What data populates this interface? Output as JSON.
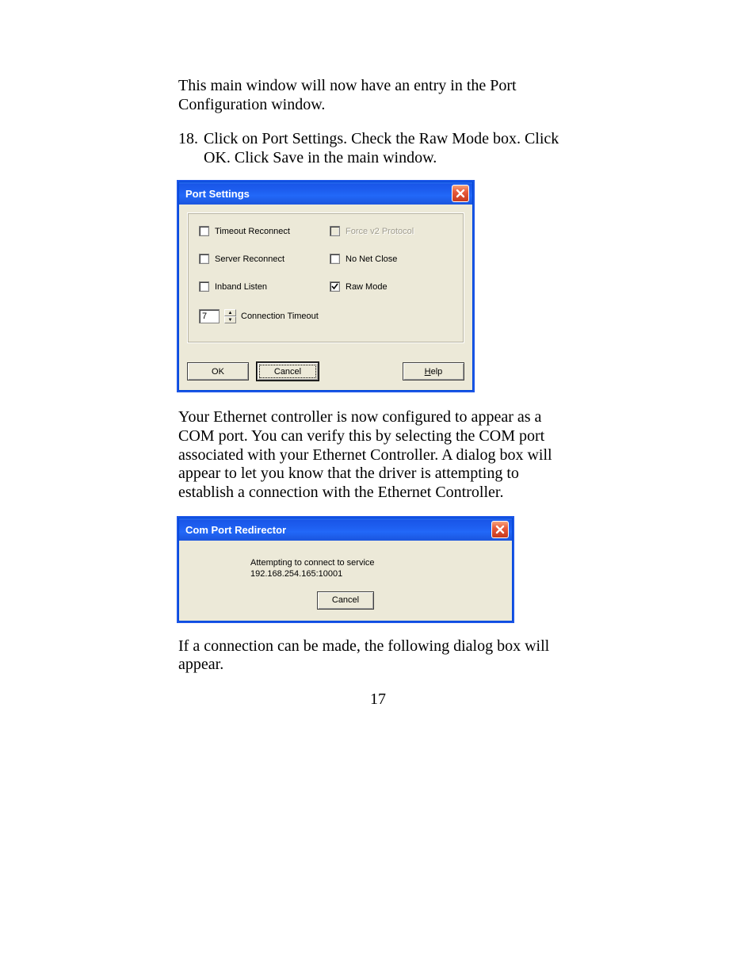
{
  "doc": {
    "para1": "This main window will now have an entry in the Port Configuration window.",
    "step_num": "18.",
    "step_text": "Click on Port Settings.  Check the Raw Mode box.  Click OK.  Click Save in the main window.",
    "para2": "Your Ethernet controller is now configured to appear as a COM port.  You can verify this by selecting the COM port associated with your Ethernet Controller.  A dialog box will appear to let you know that the driver is attempting to establish a connection with the Ethernet Controller.",
    "para3": "If a connection can be made, the following dialog box will appear.",
    "page_number": "17"
  },
  "port_settings_dialog": {
    "title": "Port Settings",
    "checkboxes": {
      "timeout_reconnect": {
        "label": "Timeout Reconnect",
        "checked": false,
        "disabled": false
      },
      "force_v2_protocol": {
        "label": "Force v2 Protocol",
        "checked": false,
        "disabled": true
      },
      "server_reconnect": {
        "label": "Server Reconnect",
        "checked": false,
        "disabled": false
      },
      "no_net_close": {
        "label": "No Net Close",
        "checked": false,
        "disabled": false
      },
      "inband_listen": {
        "label": "Inband Listen",
        "checked": false,
        "disabled": false
      },
      "raw_mode": {
        "label": "Raw Mode",
        "checked": true,
        "disabled": false
      }
    },
    "connection_timeout": {
      "label": "Connection Timeout",
      "value": "7"
    },
    "buttons": {
      "ok": "OK",
      "cancel": "Cancel",
      "help": "Help"
    }
  },
  "redirector_dialog": {
    "title": "Com Port Redirector",
    "message_line1": "Attempting to connect to service",
    "message_line2": "192.168.254.165:10001",
    "cancel": "Cancel"
  }
}
